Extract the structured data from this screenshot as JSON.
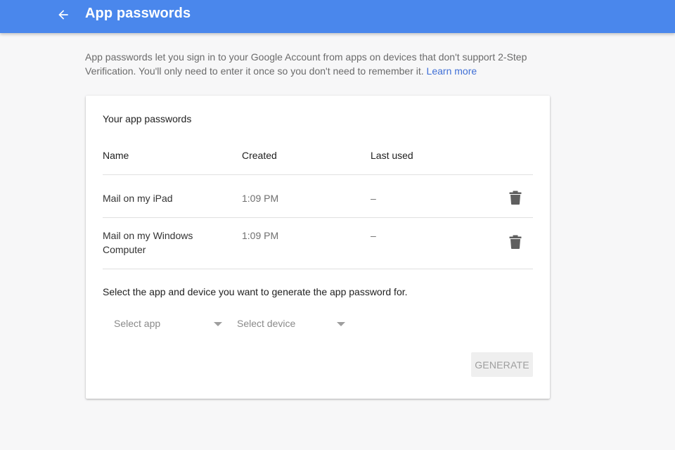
{
  "colors": {
    "appbar": "#4a87ec",
    "link": "#3f6fd6",
    "background": "#f7f7f8"
  },
  "header": {
    "back_icon": "arrow-back-icon",
    "title": "App passwords"
  },
  "intro": {
    "text": "App passwords let you sign in to your Google Account from apps on devices that don't support 2-Step Verification. You'll only need to enter it once so you don't need to remember it.",
    "link_label": "Learn more"
  },
  "card": {
    "title": "Your app passwords",
    "columns": {
      "name": "Name",
      "created": "Created",
      "last_used": "Last used"
    },
    "rows": [
      {
        "name": "Mail on my iPad",
        "created": "1:09 PM",
        "last_used": "–",
        "action_icon": "trash-icon"
      },
      {
        "name": "Mail on my Windows Computer",
        "created": "1:09 PM",
        "last_used": "–",
        "action_icon": "trash-icon"
      }
    ],
    "prompt": "Select the app and device you want to generate the app password for.",
    "select_app": {
      "value": "Select app"
    },
    "select_device": {
      "value": "Select device"
    },
    "generate_label": "GENERATE"
  }
}
